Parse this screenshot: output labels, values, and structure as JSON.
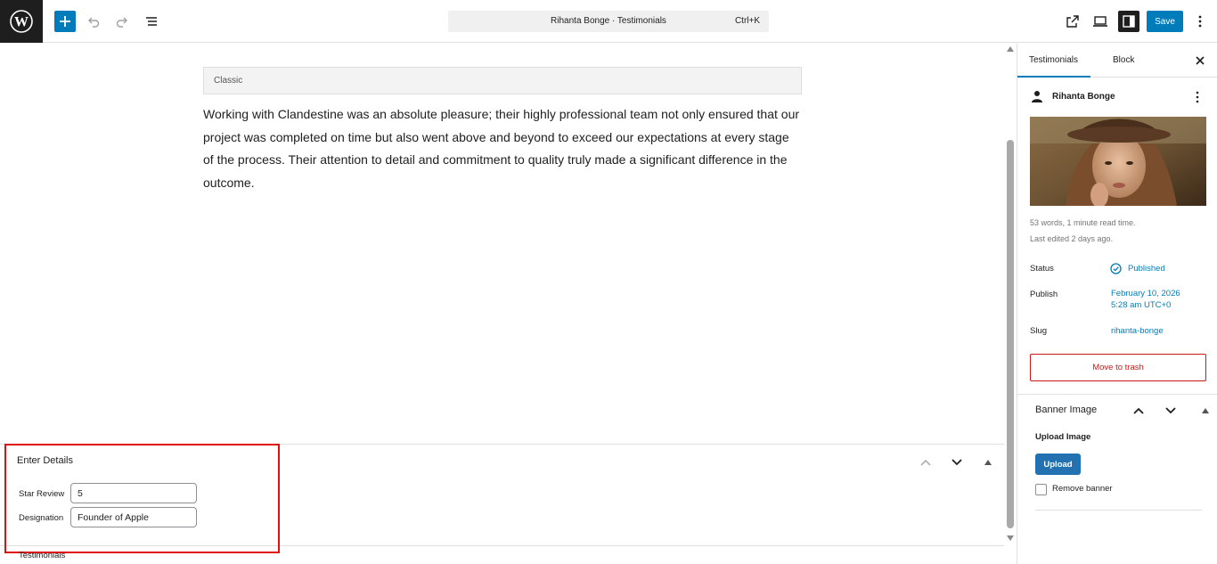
{
  "topbar": {
    "command_title": "Rihanta Bonge · Testimonials",
    "command_shortcut": "Ctrl+K",
    "save_label": "Save"
  },
  "editor": {
    "classic_label": "Classic",
    "content": "Working with Clandestine was an absolute pleasure; their highly professional team not only ensured that our project was completed on time but also went above and beyond to exceed our expectations at every stage of the process. Their attention to detail and commitment to quality truly made a significant difference in the outcome."
  },
  "metabox": {
    "title": "Enter Details",
    "fields": [
      {
        "label": "Star Review",
        "value": "5"
      },
      {
        "label": "Designation",
        "value": "Founder of Apple"
      }
    ]
  },
  "footer": {
    "breadcrumb": "Testimonials"
  },
  "sidebar": {
    "tabs": [
      "Testimonials",
      "Block"
    ],
    "post_title": "Rihanta Bonge",
    "word_count": "53 words, 1 minute read time.",
    "last_edited": "Last edited 2 days ago.",
    "status_label": "Status",
    "status_value": "Published",
    "publish_label": "Publish",
    "publish_date": "February 10, 2026",
    "publish_time": "5:28 am UTC+0",
    "slug_label": "Slug",
    "slug_value": "rihanta-bonge",
    "trash_label": "Move to trash",
    "banner": {
      "title": "Banner Image",
      "upload_label": "Upload Image",
      "upload_button": "Upload",
      "remove_label": "Remove banner"
    }
  },
  "colors": {
    "accent": "#007cba",
    "danger": "#cc1818",
    "highlight": "#e01010",
    "dark": "#1e1e1e"
  }
}
